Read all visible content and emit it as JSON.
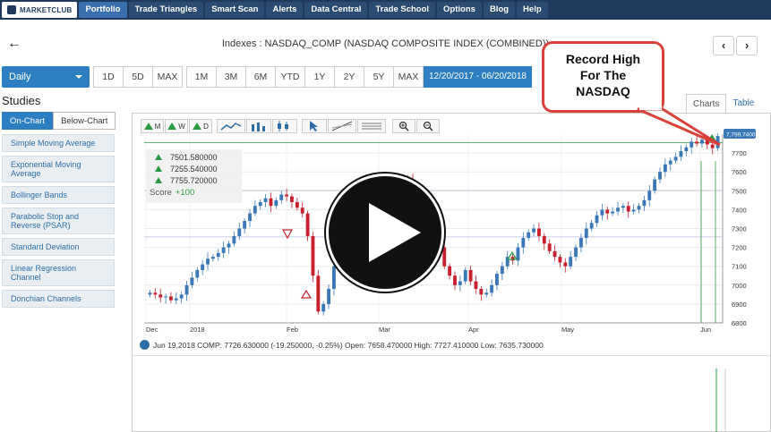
{
  "nav": {
    "logo": "MARKETCLUB",
    "items": [
      "Portfolio",
      "Trade Triangles",
      "Smart Scan",
      "Alerts",
      "Data Central",
      "Trade School",
      "Options",
      "Blog",
      "Help"
    ]
  },
  "header": {
    "title": "Indexes : NASDAQ_COMP (NASDAQ COMPOSITE INDEX (COMBINED))",
    "back": "←",
    "prev": "‹",
    "next": "›"
  },
  "toolbar": {
    "interval": "Daily",
    "ranges_left": [
      "1D",
      "5D",
      "MAX"
    ],
    "ranges_right": [
      "1M",
      "3M",
      "6M",
      "YTD",
      "1Y",
      "2Y",
      "5Y",
      "MAX"
    ],
    "date_range": "12/20/2017 - 06/20/2018"
  },
  "studies": {
    "title": "Studies",
    "tabs": [
      "On-Chart",
      "Below-Chart"
    ],
    "items": [
      "Simple Moving Average",
      "Exponential Moving Average",
      "Bollinger Bands",
      "Parabolic Stop and Reverse (PSAR)",
      "Standard Deviation",
      "Linear Regression Channel",
      "Donchian Channels"
    ]
  },
  "chart_tabs": [
    "Charts",
    "Table"
  ],
  "tools": {
    "triangle_labels": [
      "M",
      "W",
      "D"
    ],
    "zoom_in": "+",
    "zoom_out": "−"
  },
  "info": {
    "levels": [
      "7501.580000",
      "7255.540000",
      "7755.720000"
    ],
    "score_label": "Score",
    "score_value": "+100"
  },
  "status_line": "Jun 19,2018 COMP: 7726.630000 (-19.250000, -0.25%) Open: 7658.470000 High: 7727.410000 Low: 7635.730000",
  "callout": [
    "Record High",
    "For The",
    "NASDAQ"
  ],
  "colors": {
    "nav_bg": "#1f3a5c",
    "accent": "#2e7fc2",
    "up": "#3a78b8",
    "down": "#c8202e",
    "callout_border": "#d9413a"
  },
  "chart_data": {
    "type": "candlestick",
    "last_price_label": "7,799.7400",
    "ylim": [
      6800,
      7800
    ],
    "y_ticks": [
      "7700",
      "7600",
      "7500",
      "7400",
      "7300",
      "7200",
      "7100",
      "7000",
      "6900",
      "6800"
    ],
    "x_ticks": [
      "Dec",
      "2018",
      "Feb",
      "Mar",
      "Apr",
      "May",
      "Jun"
    ],
    "levels": [
      7501.58,
      7255.54,
      7755.72
    ],
    "series": [
      {
        "name": "COMP",
        "values": [
          6960,
          6950,
          6935,
          6940,
          6920,
          6930,
          6950,
          7000,
          7040,
          7080,
          7110,
          7140,
          7150,
          7170,
          7200,
          7220,
          7260,
          7300,
          7340,
          7380,
          7420,
          7440,
          7460,
          7420,
          7450,
          7480,
          7470,
          7440,
          7410,
          7380,
          7260,
          7050,
          6860,
          6900,
          6980,
          7100,
          7150,
          7180,
          7140,
          7240,
          7300,
          7350,
          7280,
          7410,
          7360,
          7420,
          7330,
          7480,
          7540,
          7560,
          7500,
          7460,
          7420,
          7380,
          7300,
          7200,
          7100,
          7050,
          7000,
          7020,
          7080,
          7020,
          6980,
          6950,
          6960,
          7000,
          7060,
          7100,
          7150,
          7130,
          7200,
          7250,
          7280,
          7300,
          7260,
          7220,
          7180,
          7150,
          7120,
          7100,
          7150,
          7200,
          7250,
          7300,
          7330,
          7370,
          7400,
          7380,
          7390,
          7410,
          7420,
          7390,
          7400,
          7420,
          7450,
          7500,
          7560,
          7600,
          7640,
          7660,
          7680,
          7710,
          7730,
          7760,
          7750,
          7770,
          7745,
          7726,
          7790
        ]
      }
    ]
  }
}
